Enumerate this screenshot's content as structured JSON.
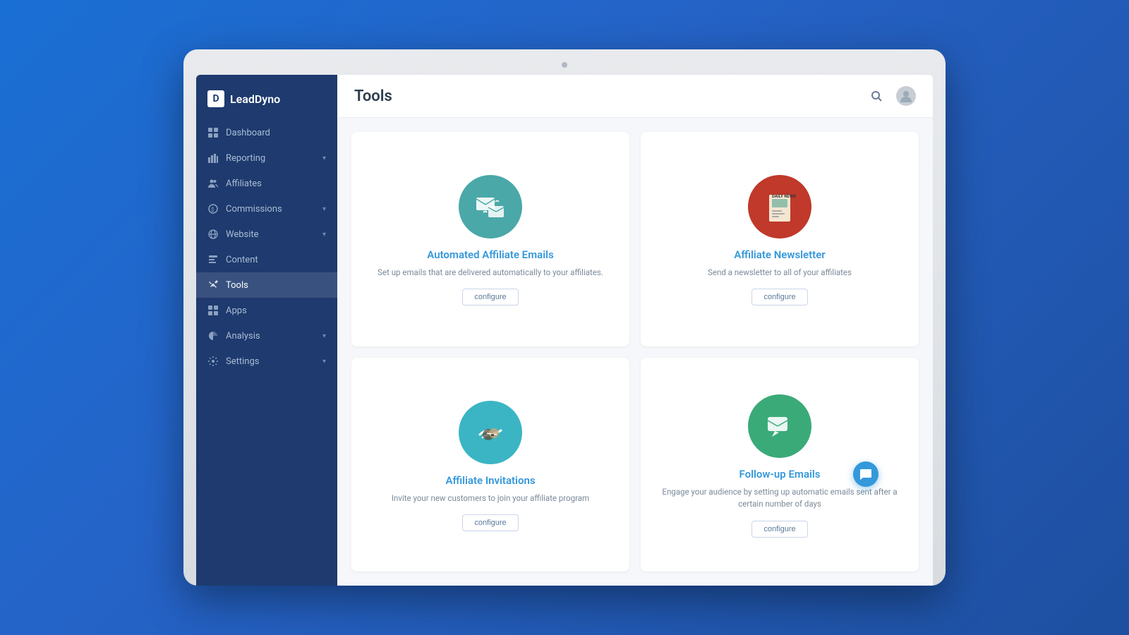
{
  "app": {
    "logo_text": "LeadDyno",
    "logo_letter": "D"
  },
  "header": {
    "title": "Tools"
  },
  "sidebar": {
    "items": [
      {
        "id": "dashboard",
        "label": "Dashboard",
        "icon": "⌂",
        "has_arrow": false,
        "active": false
      },
      {
        "id": "reporting",
        "label": "Reporting",
        "icon": "📊",
        "has_arrow": true,
        "active": false
      },
      {
        "id": "affiliates",
        "label": "Affiliates",
        "icon": "👥",
        "has_arrow": false,
        "active": false
      },
      {
        "id": "commissions",
        "label": "Commissions",
        "icon": "◎",
        "has_arrow": true,
        "active": false
      },
      {
        "id": "website",
        "label": "Website",
        "icon": "🌐",
        "has_arrow": true,
        "active": false
      },
      {
        "id": "content",
        "label": "Content",
        "icon": "⊡",
        "has_arrow": false,
        "active": false
      },
      {
        "id": "tools",
        "label": "Tools",
        "icon": "✕",
        "has_arrow": false,
        "active": true
      },
      {
        "id": "apps",
        "label": "Apps",
        "icon": "⊞",
        "has_arrow": false,
        "active": false
      },
      {
        "id": "analysis",
        "label": "Analysis",
        "icon": "◑",
        "has_arrow": true,
        "active": false
      },
      {
        "id": "settings",
        "label": "Settings",
        "icon": "⚙",
        "has_arrow": true,
        "active": false
      }
    ]
  },
  "tools": {
    "cards": [
      {
        "id": "automated-emails",
        "title": "Automated Affiliate Emails",
        "description": "Set up emails that are delivered automatically to your affiliates.",
        "configure_label": "configure",
        "icon_color": "#4aa8a8"
      },
      {
        "id": "newsletter",
        "title": "Affiliate Newsletter",
        "description": "Send a newsletter to all of your affiliates",
        "configure_label": "configure",
        "icon_color": "#c0392b"
      },
      {
        "id": "invitations",
        "title": "Affiliate Invitations",
        "description": "Invite your new customers to join your affiliate program",
        "configure_label": "configure",
        "icon_color": "#3bb5c4"
      },
      {
        "id": "followup",
        "title": "Follow-up Emails",
        "description": "Engage your audience by setting up automatic emails sent after a certain number of days",
        "configure_label": "configure",
        "icon_color": "#3aaa78"
      }
    ]
  }
}
